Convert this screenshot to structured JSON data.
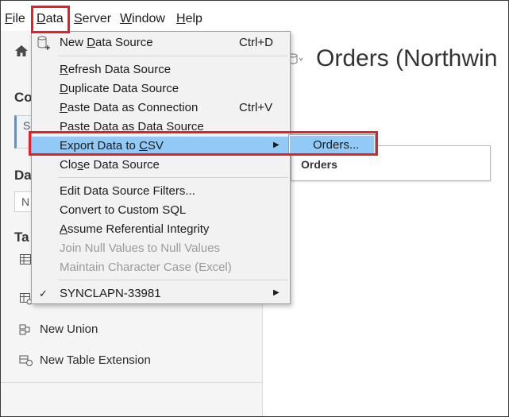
{
  "menubar": {
    "items": [
      {
        "label": "File",
        "mnemonic": "F",
        "rest": "ile"
      },
      {
        "label": "Data",
        "mnemonic": "D",
        "rest": "ata"
      },
      {
        "label": "Server",
        "mnemonic": "S",
        "rest": "erver"
      },
      {
        "label": "Window",
        "mnemonic": "W",
        "rest": "indow"
      },
      {
        "label": "Help",
        "mnemonic": "H",
        "rest": "elp"
      }
    ]
  },
  "sidebar": {
    "conn_head": "Co",
    "conn_box": "S",
    "ds_head": "Da",
    "ds_box": "N",
    "tables_head": "Ta",
    "new_union": "New Union",
    "new_table_extension": "New Table Extension"
  },
  "canvas": {
    "title": "Orders (Northwin",
    "card_label": "Orders"
  },
  "data_menu": {
    "new_data_source": {
      "pre": "New ",
      "u": "D",
      "post": "ata Source",
      "shortcut": "Ctrl+D"
    },
    "refresh": {
      "pre": "",
      "u": "R",
      "post": "efresh Data Source"
    },
    "duplicate": {
      "pre": "",
      "u": "D",
      "post": "uplicate Data Source"
    },
    "paste_connection": {
      "pre": "",
      "u": "P",
      "post": "aste Data as Connection",
      "shortcut": "Ctrl+V"
    },
    "paste_data_source": {
      "pre": "Paste Data as Data Source"
    },
    "export_csv": {
      "pre": "Export Data to ",
      "u": "C",
      "post": "SV"
    },
    "close": {
      "pre": "Clo",
      "u": "s",
      "post": "e Data Source"
    },
    "edit_filters": {
      "pre": "Edit Data Source Filters..."
    },
    "convert_sql": {
      "pre": "Convert to Custom SQL"
    },
    "referential": {
      "pre": "",
      "u": "A",
      "post": "ssume Referential Integrity"
    },
    "join_null": {
      "pre": "Join Null Values to Null Values"
    },
    "maintain_case": {
      "pre": "Maintain Character Case (Excel)"
    },
    "connection": {
      "pre": "SYNCLAPN-33981"
    }
  },
  "submenu": {
    "orders": "Orders..."
  },
  "colors": {
    "highlight": "#91c9f7",
    "annotation": "#e3202b",
    "disabled_text": "#9a9a9a"
  }
}
